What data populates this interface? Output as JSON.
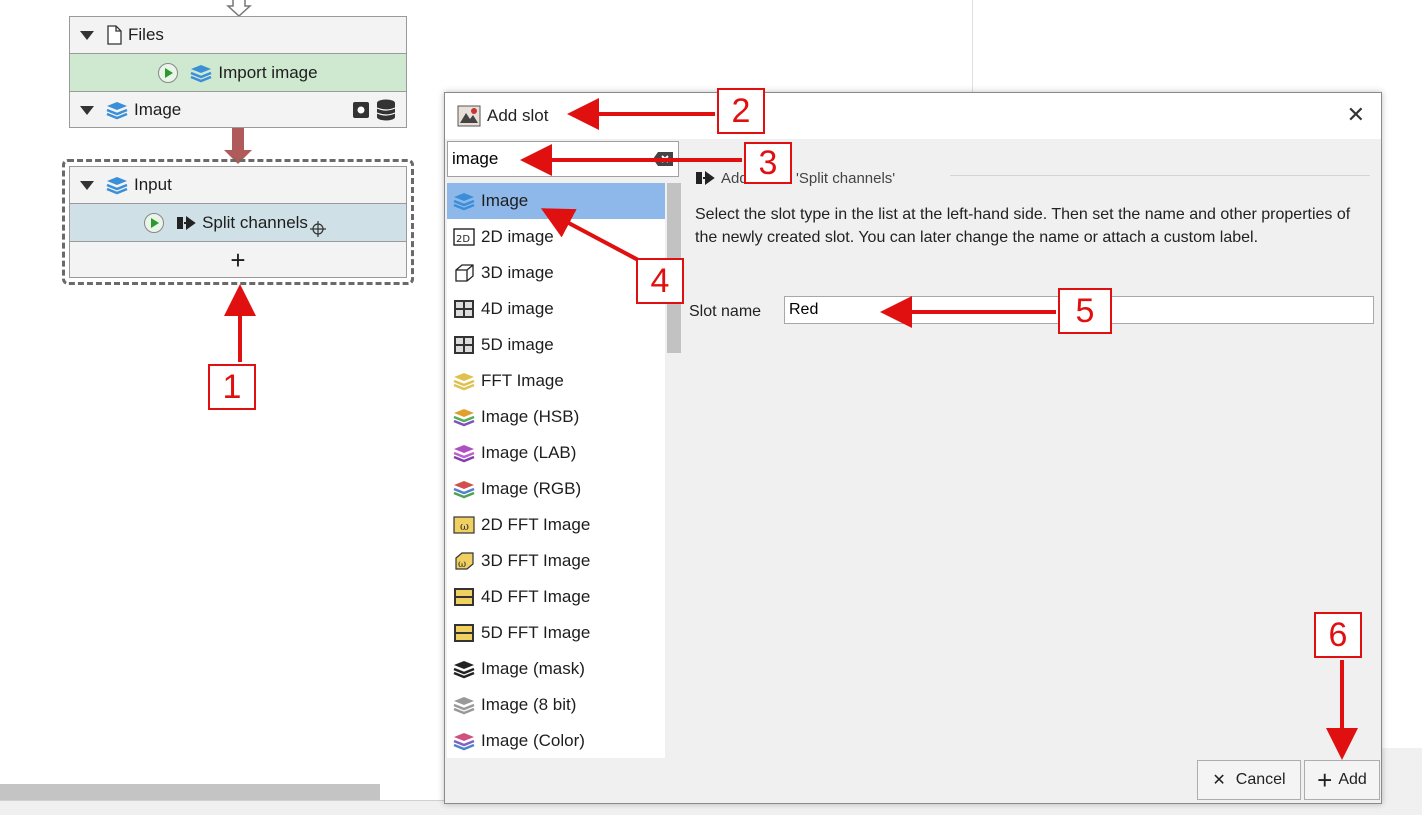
{
  "graph": {
    "files_node": {
      "header": "Files",
      "step": "Import image"
    },
    "image_node": {
      "header": "Image"
    },
    "input_node": {
      "header": "Input",
      "step": "Split channels",
      "add_symbol": "+"
    }
  },
  "dialog": {
    "title": "Add slot",
    "search_value": "image",
    "list_items": [
      {
        "label": "Image",
        "icon": "image-layers-icon",
        "selected": true
      },
      {
        "label": "2D image",
        "icon": "2d-icon"
      },
      {
        "label": "3D image",
        "icon": "3d-cube-icon"
      },
      {
        "label": "4D image",
        "icon": "4d-icon"
      },
      {
        "label": "5D image",
        "icon": "5d-icon"
      },
      {
        "label": "FFT Image",
        "icon": "fft-image-icon"
      },
      {
        "label": "Image (HSB)",
        "icon": "hsb-image-icon"
      },
      {
        "label": "Image (LAB)",
        "icon": "lab-image-icon"
      },
      {
        "label": "Image (RGB)",
        "icon": "rgb-image-icon"
      },
      {
        "label": "2D FFT Image",
        "icon": "2d-fft-icon"
      },
      {
        "label": "3D FFT Image",
        "icon": "3d-fft-icon"
      },
      {
        "label": "4D FFT Image",
        "icon": "4d-fft-icon"
      },
      {
        "label": "5D FFT Image",
        "icon": "5d-fft-icon"
      },
      {
        "label": "Image (mask)",
        "icon": "mask-image-icon"
      },
      {
        "label": "Image (8 bit)",
        "icon": "8bit-image-icon"
      },
      {
        "label": "Image (Color)",
        "icon": "color-image-icon"
      }
    ],
    "header": "Add slot to 'Split channels'",
    "description": "Select the slot type in the list at the left-hand side. Then set the name and other properties of the newly created slot. You can later change the name or attach a custom label.",
    "slot_name_label": "Slot name",
    "slot_name_value": "Red",
    "cancel_label": "Cancel",
    "add_label": "Add"
  },
  "annotations": [
    "1",
    "2",
    "3",
    "4",
    "5",
    "6"
  ],
  "colors": {
    "accent": "#e01010",
    "selected": "#8fb8ea",
    "node_green": "#cfe8d0",
    "node_blue": "#cfe1e6"
  }
}
